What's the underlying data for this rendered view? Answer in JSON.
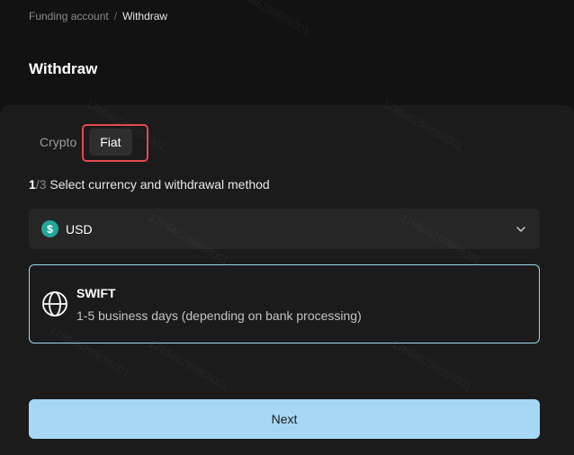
{
  "breadcrumb": {
    "parent": "Funding account",
    "separator": "/",
    "current": "Withdraw"
  },
  "page": {
    "title": "Withdraw"
  },
  "tabs": [
    {
      "label": "Crypto",
      "active": false
    },
    {
      "label": "Fiat",
      "active": true
    }
  ],
  "step": {
    "current": "1",
    "total": "/3",
    "text": " Select currency and withdrawal method"
  },
  "currency": {
    "icon": "dollar-coin-icon",
    "icon_symbol": "$",
    "value": "USD"
  },
  "method": {
    "icon": "globe-icon",
    "name": "SWIFT",
    "description": "1-5 business days (depending on bank processing)"
  },
  "actions": {
    "next_label": "Next"
  },
  "watermark": "176646299656001",
  "colors": {
    "background": "#121212",
    "card": "#1b1b1b",
    "accent": "#a6d8f5",
    "highlight": "#e5484d",
    "coin": "#26a69a"
  }
}
